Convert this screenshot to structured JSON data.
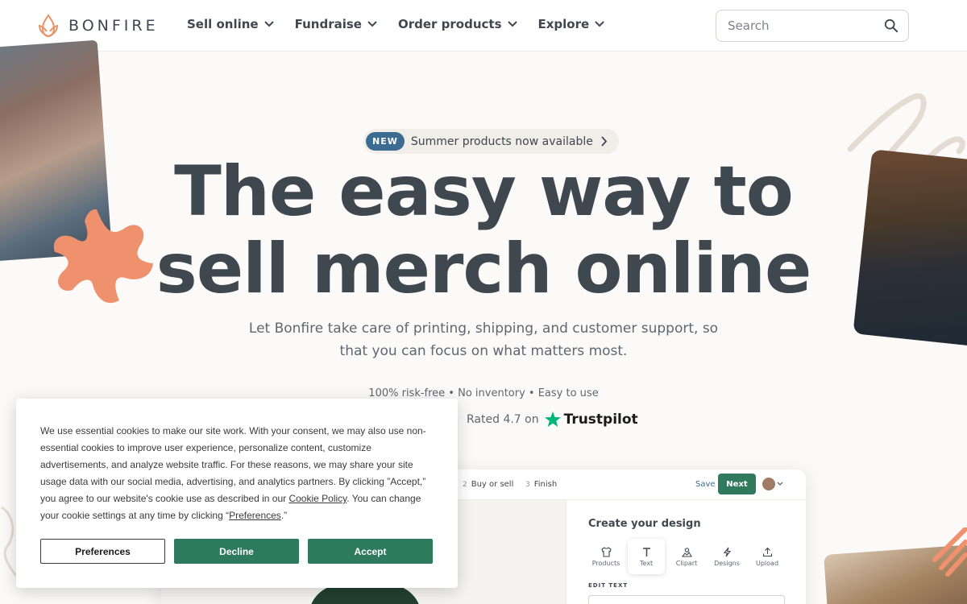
{
  "header": {
    "logo_text": "BONFIRE",
    "nav": [
      {
        "label": "Sell online"
      },
      {
        "label": "Fundraise"
      },
      {
        "label": "Order products"
      },
      {
        "label": "Explore"
      }
    ],
    "search_placeholder": "Search"
  },
  "hero": {
    "badge": "NEW",
    "badge_text": "Summer products now available",
    "headline_line1": "The easy way to",
    "headline_line2": "sell merch online",
    "subhead": "Let Bonfire take care of printing, shipping, and customer support, so that you can focus on what matters most.",
    "features": "100% risk-free • No inventory • Easy to use",
    "rating_text": "Rated 4.7 on",
    "trustpilot": "Trustpilot"
  },
  "preview": {
    "steps": [
      {
        "num": "2",
        "label": "Buy or sell"
      },
      {
        "num": "3",
        "label": "Finish"
      }
    ],
    "save": "Save",
    "next": "Next",
    "panel_title": "Create your design",
    "tools": [
      {
        "label": "Products",
        "icon": "shirt-icon"
      },
      {
        "label": "Text",
        "icon": "text-icon"
      },
      {
        "label": "Clipart",
        "icon": "clipart-icon"
      },
      {
        "label": "Designs",
        "icon": "lightning-icon"
      },
      {
        "label": "Upload",
        "icon": "upload-icon"
      }
    ],
    "edit_label": "EDIT TEXT"
  },
  "cookie": {
    "text_before": "We use essential cookies to make our site work. With your consent, we may also use non-essential cookies to improve user experience, personalize content, customize advertisements, and analyze website traffic. For these reasons, we may share your site usage data with our social media, advertising, and analytics partners. By clicking ”Accept,” you agree to our website's cookie use as described in our ",
    "policy_link": "Cookie Policy",
    "text_middle": ". You can change your cookie settings at any time by clicking “",
    "preferences_link": "Preferences",
    "text_after": ".”",
    "buttons": {
      "preferences": "Preferences",
      "decline": "Decline",
      "accept": "Accept"
    }
  },
  "colors": {
    "accent_green": "#2e7a5c",
    "badge_blue": "#3c6c92",
    "logo_orange": "#e8936a",
    "headline": "#3f474f"
  }
}
